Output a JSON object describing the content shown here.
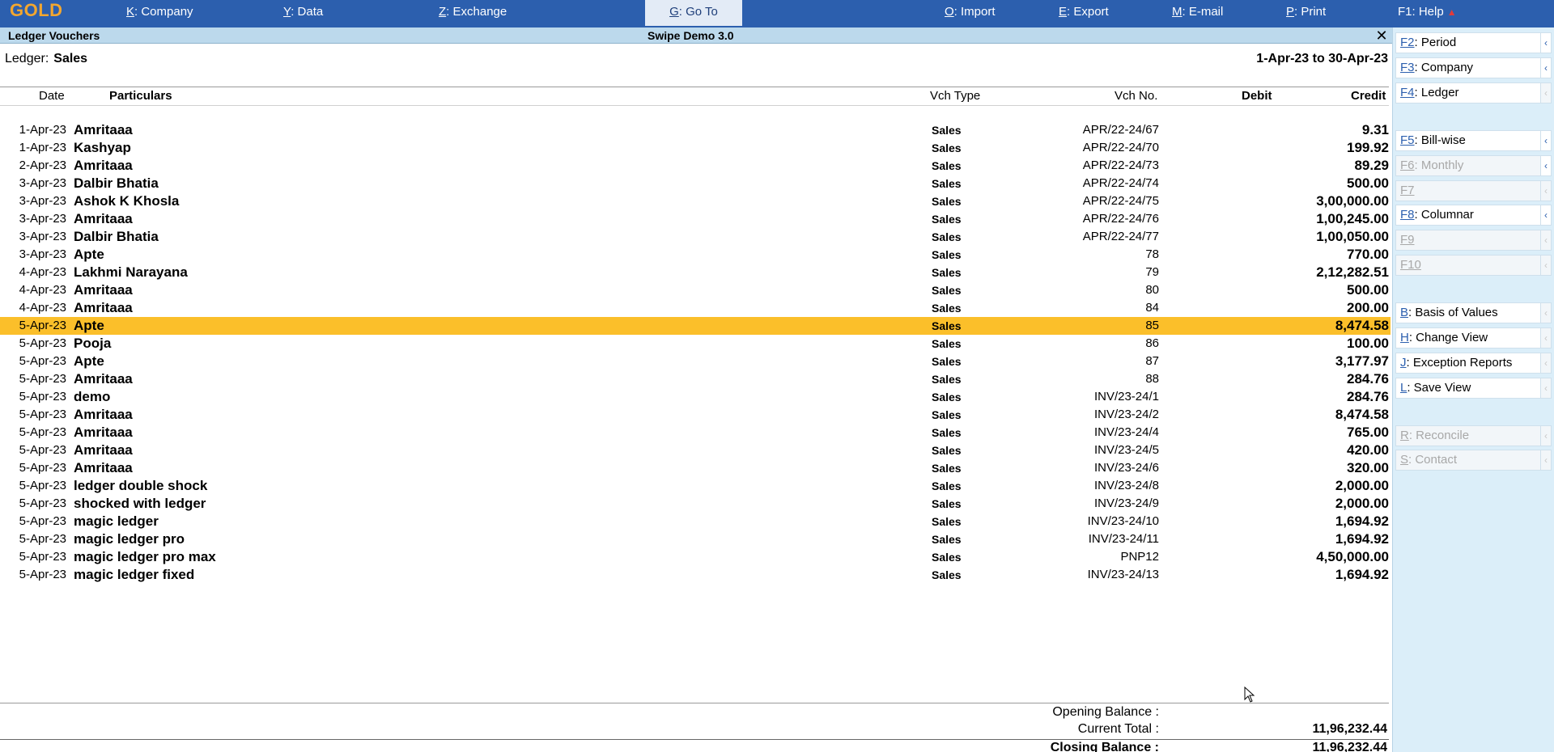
{
  "app": {
    "logo": "GOLD"
  },
  "menu": {
    "company": {
      "key": "K",
      "label": ": Company"
    },
    "data": {
      "key": "Y",
      "label": ": Data"
    },
    "exchange": {
      "key": "Z",
      "label": ": Exchange"
    },
    "goto": {
      "key": "G",
      "label": ": Go To"
    },
    "import": {
      "key": "O",
      "label": ": Import"
    },
    "export": {
      "key": "E",
      "label": ": Export"
    },
    "email": {
      "key": "M",
      "label": ": E-mail"
    },
    "print": {
      "key": "P",
      "label": ": Print"
    },
    "help": {
      "key": "F1",
      "label": ": Help"
    }
  },
  "titlebar": {
    "screen": "Ledger Vouchers",
    "company": "Swipe Demo 3.0",
    "close": "✕"
  },
  "ledger": {
    "label": "Ledger:",
    "name": "Sales",
    "period": "1-Apr-23 to 30-Apr-23"
  },
  "columns": {
    "date": "Date",
    "particulars": "Particulars",
    "vch_type": "Vch Type",
    "vch_no": "Vch No.",
    "debit": "Debit",
    "credit": "Credit"
  },
  "rows": [
    {
      "date": "1-Apr-23",
      "particulars": "Amritaaa",
      "vch_type": "Sales",
      "vch_no": "APR/22-24/67",
      "credit": "9.31"
    },
    {
      "date": "1-Apr-23",
      "particulars": "Kashyap",
      "vch_type": "Sales",
      "vch_no": "APR/22-24/70",
      "credit": "199.92"
    },
    {
      "date": "2-Apr-23",
      "particulars": "Amritaaa",
      "vch_type": "Sales",
      "vch_no": "APR/22-24/73",
      "credit": "89.29"
    },
    {
      "date": "3-Apr-23",
      "particulars": "Dalbir Bhatia",
      "vch_type": "Sales",
      "vch_no": "APR/22-24/74",
      "credit": "500.00"
    },
    {
      "date": "3-Apr-23",
      "particulars": "Ashok K Khosla",
      "vch_type": "Sales",
      "vch_no": "APR/22-24/75",
      "credit": "3,00,000.00"
    },
    {
      "date": "3-Apr-23",
      "particulars": "Amritaaa",
      "vch_type": "Sales",
      "vch_no": "APR/22-24/76",
      "credit": "1,00,245.00"
    },
    {
      "date": "3-Apr-23",
      "particulars": "Dalbir Bhatia",
      "vch_type": "Sales",
      "vch_no": "APR/22-24/77",
      "credit": "1,00,050.00"
    },
    {
      "date": "3-Apr-23",
      "particulars": "Apte",
      "vch_type": "Sales",
      "vch_no": "78",
      "credit": "770.00"
    },
    {
      "date": "4-Apr-23",
      "particulars": "Lakhmi Narayana",
      "vch_type": "Sales",
      "vch_no": "79",
      "credit": "2,12,282.51"
    },
    {
      "date": "4-Apr-23",
      "particulars": "Amritaaa",
      "vch_type": "Sales",
      "vch_no": "80",
      "credit": "500.00"
    },
    {
      "date": "4-Apr-23",
      "particulars": "Amritaaa",
      "vch_type": "Sales",
      "vch_no": "84",
      "credit": "200.00"
    },
    {
      "date": "5-Apr-23",
      "particulars": "Apte",
      "vch_type": "Sales",
      "vch_no": "85",
      "credit": "8,474.58",
      "selected": true
    },
    {
      "date": "5-Apr-23",
      "particulars": "Pooja",
      "vch_type": "Sales",
      "vch_no": "86",
      "credit": "100.00"
    },
    {
      "date": "5-Apr-23",
      "particulars": "Apte",
      "vch_type": "Sales",
      "vch_no": "87",
      "credit": "3,177.97"
    },
    {
      "date": "5-Apr-23",
      "particulars": "Amritaaa",
      "vch_type": "Sales",
      "vch_no": "88",
      "credit": "284.76"
    },
    {
      "date": "5-Apr-23",
      "particulars": "demo",
      "vch_type": "Sales",
      "vch_no": "INV/23-24/1",
      "credit": "284.76"
    },
    {
      "date": "5-Apr-23",
      "particulars": "Amritaaa",
      "vch_type": "Sales",
      "vch_no": "INV/23-24/2",
      "credit": "8,474.58"
    },
    {
      "date": "5-Apr-23",
      "particulars": "Amritaaa",
      "vch_type": "Sales",
      "vch_no": "INV/23-24/4",
      "credit": "765.00"
    },
    {
      "date": "5-Apr-23",
      "particulars": "Amritaaa",
      "vch_type": "Sales",
      "vch_no": "INV/23-24/5",
      "credit": "420.00"
    },
    {
      "date": "5-Apr-23",
      "particulars": "Amritaaa",
      "vch_type": "Sales",
      "vch_no": "INV/23-24/6",
      "credit": "320.00"
    },
    {
      "date": "5-Apr-23",
      "particulars": "ledger double shock",
      "vch_type": "Sales",
      "vch_no": "INV/23-24/8",
      "credit": "2,000.00"
    },
    {
      "date": "5-Apr-23",
      "particulars": "shocked with ledger",
      "vch_type": "Sales",
      "vch_no": "INV/23-24/9",
      "credit": "2,000.00"
    },
    {
      "date": "5-Apr-23",
      "particulars": "magic ledger",
      "vch_type": "Sales",
      "vch_no": "INV/23-24/10",
      "credit": "1,694.92"
    },
    {
      "date": "5-Apr-23",
      "particulars": "magic ledger pro",
      "vch_type": "Sales",
      "vch_no": "INV/23-24/11",
      "credit": "1,694.92"
    },
    {
      "date": "5-Apr-23",
      "particulars": "magic ledger pro max",
      "vch_type": "Sales",
      "vch_no": "PNP12",
      "credit": "4,50,000.00"
    },
    {
      "date": "5-Apr-23",
      "particulars": "magic ledger fixed",
      "vch_type": "Sales",
      "vch_no": "INV/23-24/13",
      "credit": "1,694.92"
    }
  ],
  "totals": {
    "opening_label": "Opening Balance :",
    "current_label": "Current Total :",
    "current_value": "11,96,232.44",
    "closing_label": "Closing Balance :",
    "closing_value": "11,96,232.44"
  },
  "panel": {
    "period": {
      "key": "F2",
      "label": ": Period"
    },
    "company": {
      "key": "F3",
      "label": ": Company"
    },
    "ledger": {
      "key": "F4",
      "label": ": Ledger"
    },
    "billwise": {
      "key": "F5",
      "label": ": Bill-wise"
    },
    "monthly": {
      "key": "F6",
      "label": ": Monthly"
    },
    "f7": {
      "key": "F7",
      "label": ""
    },
    "columnar": {
      "key": "F8",
      "label": ": Columnar"
    },
    "f9": {
      "key": "F9",
      "label": ""
    },
    "f10": {
      "key": "F10",
      "label": ""
    },
    "basis": {
      "key": "B",
      "label": ": Basis of Values"
    },
    "changeview": {
      "key": "H",
      "label": ": Change View"
    },
    "exception": {
      "key": "J",
      "label": ": Exception Reports"
    },
    "saveview": {
      "key": "L",
      "label": ": Save View"
    },
    "reconcile": {
      "key": "R",
      "label": ": Reconcile"
    },
    "contact": {
      "key": "S",
      "label": ": Contact"
    },
    "arrow": "‹"
  },
  "icons": {
    "close": "close-icon",
    "help_warning": "warning-triangle-icon",
    "panel_arrow": "chevron-left-icon",
    "cursor": "mouse-pointer-icon"
  },
  "colors": {
    "topbar": "#2c5fae",
    "logo": "#f3a72f",
    "titlebar": "#bcd9ec",
    "selected_row": "#fbbf2a",
    "panel": "#dbeef9"
  }
}
